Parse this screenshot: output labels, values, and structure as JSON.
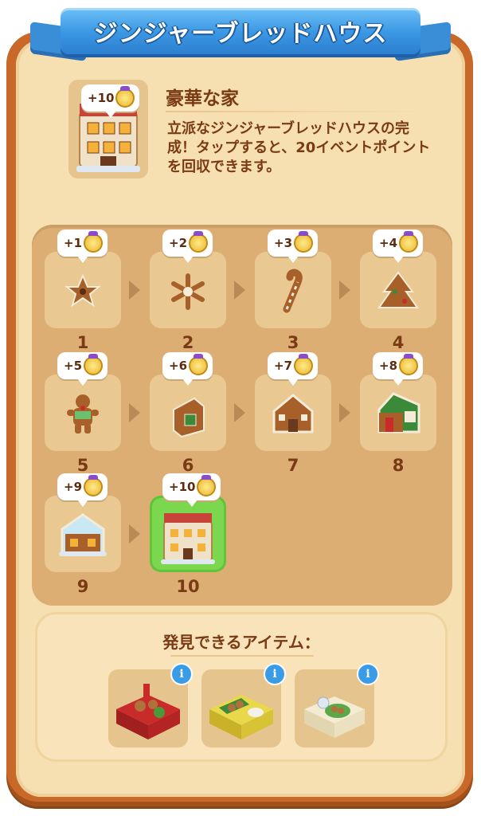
{
  "header": {
    "title": "ジンジャーブレッドハウス"
  },
  "item": {
    "name": "豪華な家",
    "description": "立派なジンジャーブレッドハウスの完成！タップすると、20イベントポイントを回収できます。",
    "reward": "+10"
  },
  "chain": [
    {
      "level": "1",
      "reward": "+1",
      "icon": "gingerbread-star-cookie-icon"
    },
    {
      "level": "2",
      "reward": "+2",
      "icon": "snowflake-cookie-icon"
    },
    {
      "level": "3",
      "reward": "+3",
      "icon": "candy-cane-cookie-icon"
    },
    {
      "level": "4",
      "reward": "+4",
      "icon": "christmas-tree-cookie-icon"
    },
    {
      "level": "5",
      "reward": "+5",
      "icon": "gingerbread-man-icon"
    },
    {
      "level": "6",
      "reward": "+6",
      "icon": "gingerbread-wall-icon"
    },
    {
      "level": "7",
      "reward": "+7",
      "icon": "small-gingerbread-house-icon"
    },
    {
      "level": "8",
      "reward": "+8",
      "icon": "gingerbread-house-icon"
    },
    {
      "level": "9",
      "reward": "+9",
      "icon": "iced-gingerbread-house-icon"
    },
    {
      "level": "10",
      "reward": "+10",
      "icon": "luxury-gingerbread-house-icon"
    }
  ],
  "discover": {
    "title": "発見できるアイテム：",
    "items": [
      {
        "icon": "red-cookie-table-icon",
        "info": "i"
      },
      {
        "icon": "yellow-icing-table-icon",
        "info": "i"
      },
      {
        "icon": "cream-cookie-table-icon",
        "info": "i"
      }
    ]
  },
  "colors": {
    "frame": "#c8692a",
    "panel": "#f6dfb1",
    "ribbon": "#3a96e3",
    "chain_bg": "#dcae74",
    "final_cell": "#7bd84e",
    "text": "#7a3a14"
  }
}
